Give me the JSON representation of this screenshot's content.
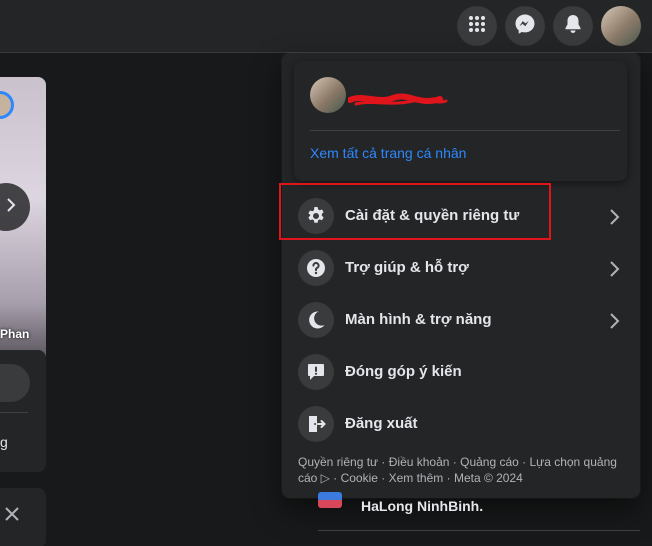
{
  "header": {
    "icons": [
      "menu-grid-icon",
      "messenger-icon",
      "notifications-bell-icon"
    ]
  },
  "feed": {
    "story_name": "Phan",
    "create_post_snippet": "g"
  },
  "menu": {
    "see_all_profiles": "Xem tất cả trang cá nhân",
    "items": [
      {
        "label": "Cài đặt & quyền riêng tư",
        "icon": "settings-gear-icon",
        "has_chevron": true
      },
      {
        "label": "Trợ giúp & hỗ trợ",
        "icon": "help-question-icon",
        "has_chevron": true
      },
      {
        "label": "Màn hình & trợ năng",
        "icon": "moon-icon",
        "has_chevron": true
      },
      {
        "label": "Đóng góp ý kiến",
        "icon": "feedback-exclamation-icon",
        "has_chevron": false
      },
      {
        "label": "Đăng xuất",
        "icon": "logout-door-icon",
        "has_chevron": false
      }
    ],
    "footer": "Quyền riêng tư · Điều khoản · Quảng cáo · Lựa chọn quảng cáo ▷ · Cookie · Xem thêm · Meta © 2024"
  },
  "sidebar_right": {
    "group_name": "HaLong NinhBinh."
  },
  "colors": {
    "accent_link": "#2d88ff",
    "highlight_box": "#e0141b",
    "panel": "#242526",
    "background": "#18191a"
  }
}
